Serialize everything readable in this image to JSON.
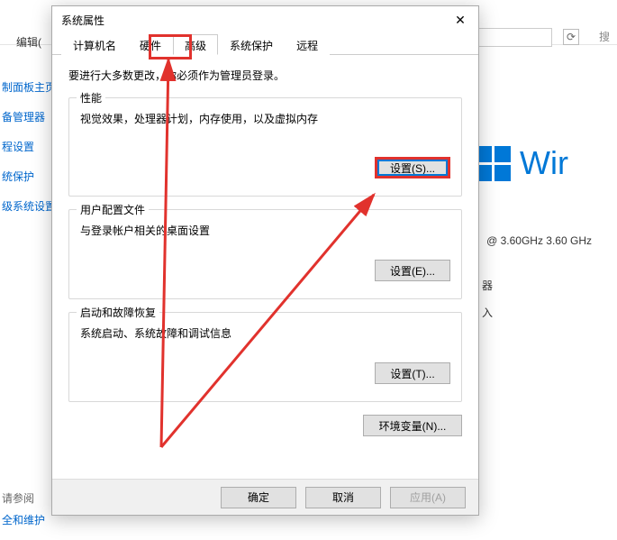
{
  "dialog": {
    "title": "系统属性",
    "admin_note": "要进行大多数更改，你必须作为管理员登录。",
    "tabs": [
      {
        "label": "计算机名"
      },
      {
        "label": "硬件"
      },
      {
        "label": "高级",
        "active": true
      },
      {
        "label": "系统保护"
      },
      {
        "label": "远程"
      }
    ],
    "group_perf": {
      "title": "性能",
      "desc": "视觉效果，处理器计划，内存使用，以及虚拟内存",
      "btn": "设置(S)..."
    },
    "group_profile": {
      "title": "用户配置文件",
      "desc": "与登录帐户相关的桌面设置",
      "btn": "设置(E)..."
    },
    "group_startup": {
      "title": "启动和故障恢复",
      "desc": "系统启动、系统故障和调试信息",
      "btn": "设置(T)..."
    },
    "env_btn": "环境变量(N)...",
    "footer": {
      "ok": "确定",
      "cancel": "取消",
      "apply": "应用(A)"
    }
  },
  "background": {
    "edit_label": "编辑(",
    "search_placeholder": "搜",
    "left_links": [
      "制面板主页",
      "备管理器",
      "程设置",
      "统保护",
      "级系统设置"
    ],
    "help": "请参阅",
    "maint": "全和维护",
    "win_text": "Wir",
    "cpu": "@ 3.60GHz   3.60 GHz",
    "r1": "器",
    "r2": "入"
  }
}
